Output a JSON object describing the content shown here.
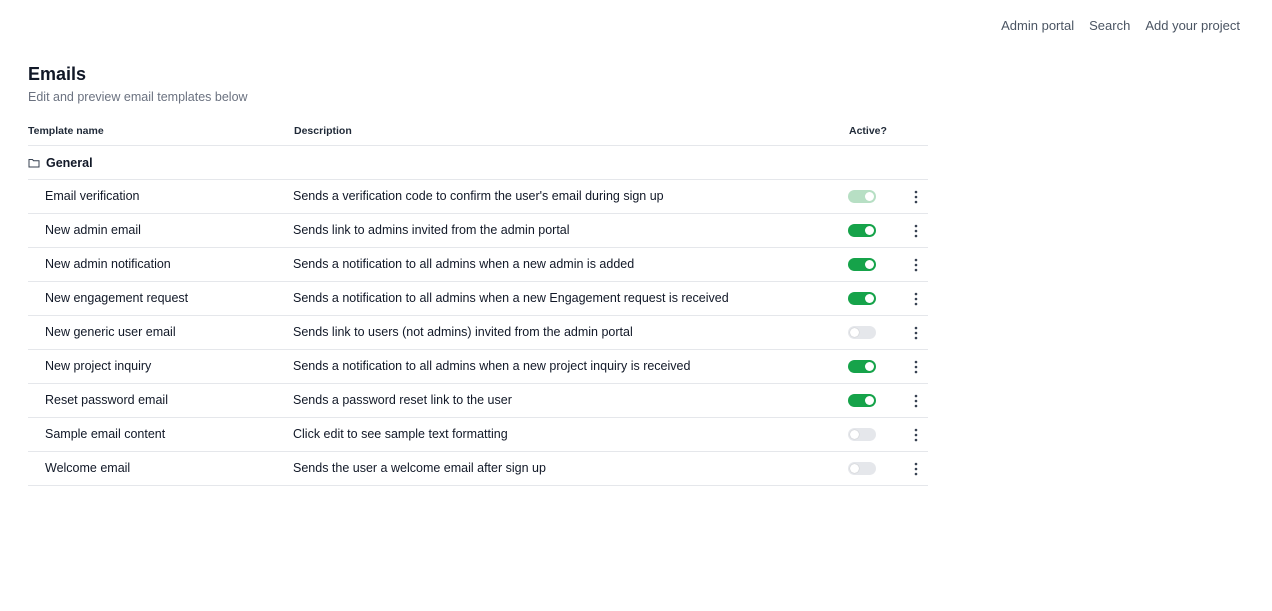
{
  "topnav": {
    "items": [
      "Admin portal",
      "Search",
      "Add your project"
    ]
  },
  "header": {
    "title": "Emails",
    "subtitle": "Edit and preview email templates below"
  },
  "table": {
    "columns": {
      "name": "Template name",
      "description": "Description",
      "active": "Active?"
    },
    "group": {
      "label": "General",
      "icon": "folder-icon"
    },
    "rows": [
      {
        "name": "Email verification",
        "description": "Sends a verification code to confirm the user's email during sign up",
        "active": "disabled-on"
      },
      {
        "name": "New admin email",
        "description": "Sends link to admins invited from the admin portal",
        "active": "on"
      },
      {
        "name": "New admin notification",
        "description": "Sends a notification to all admins when a new admin is added",
        "active": "on"
      },
      {
        "name": "New engagement request",
        "description": "Sends a notification to all admins when a new Engagement request is received",
        "active": "on"
      },
      {
        "name": "New generic user email",
        "description": "Sends link to users (not admins) invited from the admin portal",
        "active": "off"
      },
      {
        "name": "New project inquiry",
        "description": "Sends a notification to all admins when a new project inquiry is received",
        "active": "on"
      },
      {
        "name": "Reset password email",
        "description": "Sends a password reset link to the user",
        "active": "on"
      },
      {
        "name": "Sample email content",
        "description": "Click edit to see sample text formatting",
        "active": "off"
      },
      {
        "name": "Welcome email",
        "description": "Sends the user a welcome email after sign up",
        "active": "off"
      }
    ]
  },
  "colors": {
    "toggle_on": "#16a34a",
    "toggle_disabled": "#b7dfc4",
    "toggle_off": "#e5e7eb"
  }
}
